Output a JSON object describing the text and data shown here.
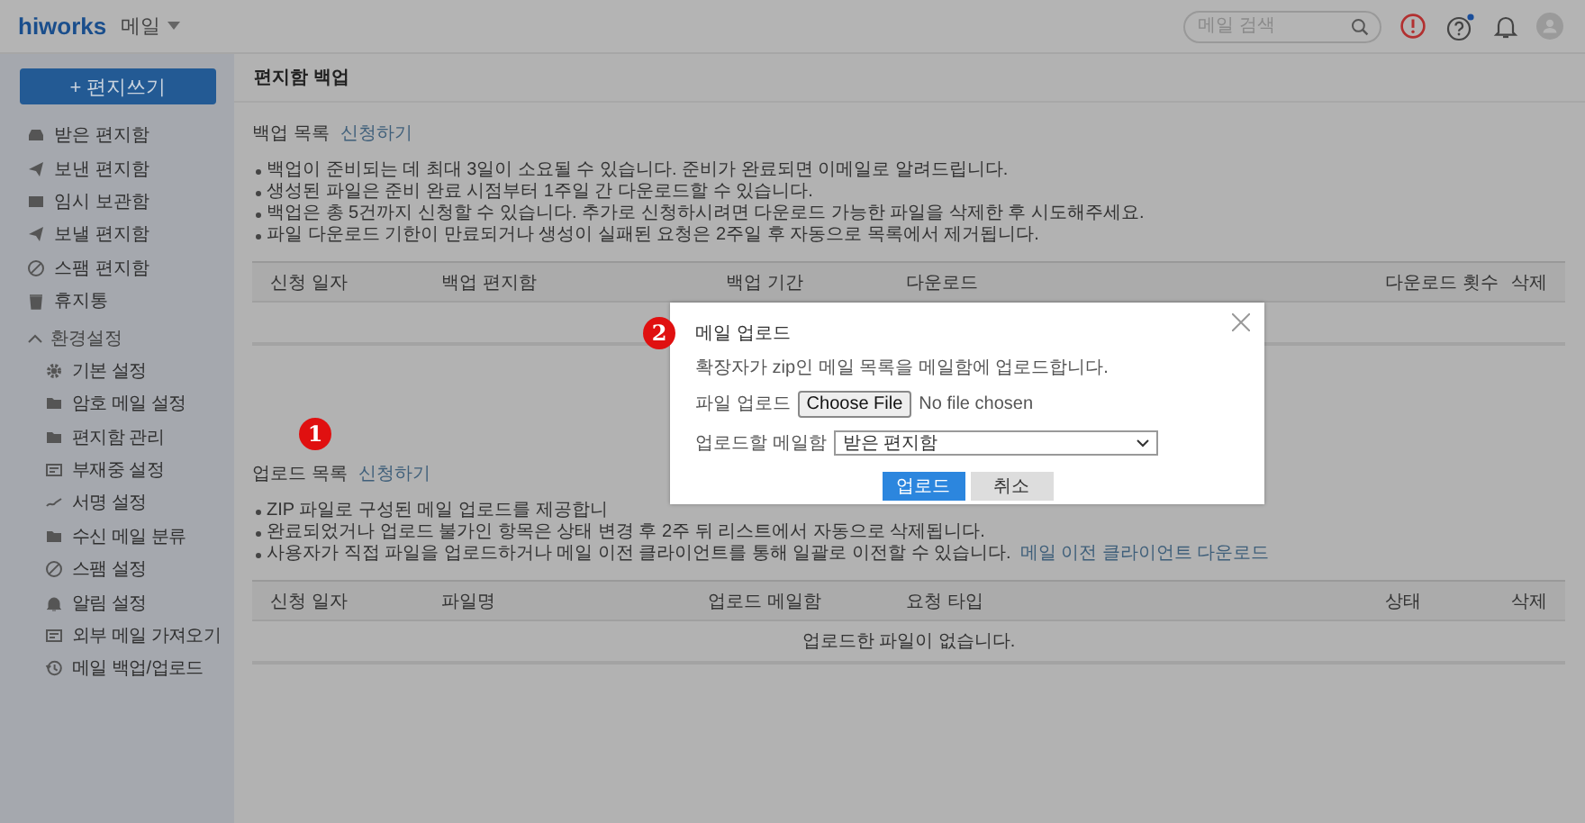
{
  "header": {
    "logo": "hiworks",
    "app_menu": "메일",
    "search": {
      "placeholder": "메일 검색"
    },
    "help_has_notice": true
  },
  "sidebar": {
    "compose": "+ 편지쓰기",
    "mailboxes": [
      "받은 편지함",
      "보낸 편지함",
      "임시 보관함",
      "보낼 편지함",
      "스팸 편지함",
      "휴지통"
    ],
    "settings": {
      "label": "환경설정",
      "expanded": true,
      "items": [
        "기본 설정",
        "암호 메일 설정",
        "편지함 관리",
        "부재중 설정",
        "서명 설정",
        "수신 메일 분류",
        "스팸 설정",
        "알림 설정",
        "외부 메일 가져오기",
        "메일 백업/업로드"
      ]
    }
  },
  "page_title": "편지함 백업",
  "backup": {
    "title": "백업 목록",
    "action": "신청하기",
    "notes": [
      "백업이 준비되는 데 최대 3일이 소요될 수 있습니다. 준비가 완료되면 이메일로 알려드립니다.",
      "생성된 파일은 준비 완료 시점부터 1주일 간 다운로드할 수 있습니다.",
      "백업은 총 5건까지 신청할 수 있습니다. 추가로 신청하시려면 다운로드 가능한 파일을 삭제한 후 시도해주세요.",
      "파일 다운로드 기한이 만료되거나 생성이 실패된 요청은 2주일 후 자동으로 목록에서 제거됩니다."
    ],
    "columns": [
      "신청 일자",
      "백업 편지함",
      "백업 기간",
      "다운로드",
      "다운로드 횟수",
      "삭제"
    ]
  },
  "upload": {
    "step_badge": "1",
    "title": "업로드 목록",
    "action": "신청하기",
    "notes": [
      {
        "text": "ZIP 파일로 구성된 메일 업로드를 제공합니"
      },
      {
        "text": "완료되었거나 업로드 불가인 항목은 상태 변경 후 2주 뒤 리스트에서 자동으로 삭제됩니다."
      },
      {
        "text": "사용자가 직접 파일을 업로드하거나 메일 이전 클라이언트를 통해 일괄로 이전할 수 있습니다.",
        "link": "메일 이전 클라이언트 다운로드"
      }
    ],
    "columns": [
      "신청 일자",
      "파일명",
      "업로드 메일함",
      "요청 타입",
      "상태",
      "삭제"
    ],
    "empty_message": "업로드한 파일이 없습니다."
  },
  "modal": {
    "step_badge": "2",
    "title": "메일 업로드",
    "description": "확장자가 zip인 메일 목록을 메일함에 업로드합니다.",
    "file_label": "파일 업로드",
    "file_button": "Choose File",
    "file_status": "No file chosen",
    "folder_label": "업로드할 메일함",
    "folder_value": "받은 편지함",
    "buttons": [
      {
        "label": "업로드",
        "kind": "primary"
      },
      {
        "label": "취소",
        "kind": "secondary"
      }
    ]
  }
}
